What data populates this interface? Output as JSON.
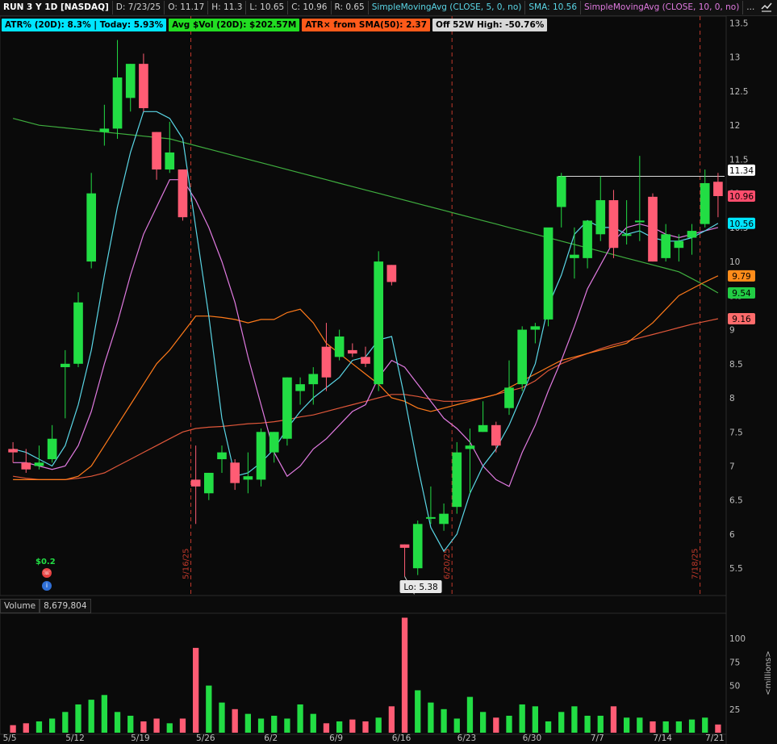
{
  "header": {
    "symbol": "RUN 3 Y 1D [NASDAQ]",
    "date": "D: 7/23/25",
    "open": "O: 11.17",
    "high": "H: 11.3",
    "low": "L: 10.65",
    "close": "C: 10.96",
    "range": "R: 0.65",
    "sma5_label": "SimpleMovingAvg (CLOSE, 5, 0, no)",
    "sma5_value": "SMA: 10.56",
    "sma10_label": "SimpleMovingAvg (CLOSE, 10, 0, no)",
    "more": "..."
  },
  "badges": [
    {
      "text": "ATR% (20D): 8.3% | Today: 5.93%",
      "color": "#00e5ff"
    },
    {
      "text": "Avg $Vol (20D): $202.57M",
      "color": "#22dd22"
    },
    {
      "text": "ATR× from SMA(50): 2.37",
      "color": "#ff5a1a"
    },
    {
      "text": "Off 52W High: -50.76%",
      "color": "#d8d8d8"
    }
  ],
  "price_axis": {
    "ticks": [
      "13.5",
      "13",
      "12.5",
      "12",
      "11.5",
      "11",
      "10.5",
      "10",
      "9.5",
      "9",
      "8.5",
      "8",
      "7.5",
      "7",
      "6.5",
      "6",
      "5.5"
    ],
    "tags": [
      {
        "label": "11.34",
        "bg": "#ffffff",
        "fg": "#000000"
      },
      {
        "label": "10.96",
        "bg": "#ff4d6d",
        "fg": "#000000"
      },
      {
        "label": "10.56",
        "bg": "#00e5ff",
        "fg": "#000000"
      },
      {
        "label": "9.79",
        "bg": "#ff8c1a",
        "fg": "#000000"
      },
      {
        "label": "9.54",
        "bg": "#22cc44",
        "fg": "#000000"
      },
      {
        "label": "9.16",
        "bg": "#ff6b6b",
        "fg": "#000000"
      }
    ]
  },
  "date_axis": [
    "5/5",
    "5/12",
    "5/19",
    "5/26",
    "6/2",
    "6/9",
    "6/16",
    "6/23",
    "6/30",
    "7/7",
    "7/14",
    "7/21"
  ],
  "vertical_markers": [
    "5/16/25",
    "6/20/25",
    "7/18/25"
  ],
  "low_label": "Lo: 5.38",
  "event": {
    "dividend": "$0.2"
  },
  "volume": {
    "label": "Volume",
    "value": "8,679,804",
    "ticks": [
      "100",
      "75",
      "50",
      "25"
    ],
    "unit": "<millions>"
  },
  "colors": {
    "up": "#22dd44",
    "down": "#ff5c74",
    "sma5": "#5ad6e6",
    "sma10": "#e07ae0",
    "sma_orange": "#ff7a1a",
    "sma_red": "#e0573a",
    "sma_green": "#3fae3f"
  },
  "chart_data": {
    "type": "candlestick",
    "ylim": [
      5.1,
      13.6
    ],
    "candles": [
      {
        "o": 7.25,
        "h": 7.35,
        "l": 7.05,
        "c": 7.2
      },
      {
        "o": 7.05,
        "h": 7.25,
        "l": 6.9,
        "c": 6.95
      },
      {
        "o": 7.0,
        "h": 7.3,
        "l": 6.95,
        "c": 7.05
      },
      {
        "o": 7.1,
        "h": 7.6,
        "l": 7.05,
        "c": 7.4
      },
      {
        "o": 8.45,
        "h": 8.7,
        "l": 7.7,
        "c": 8.5
      },
      {
        "o": 8.5,
        "h": 9.55,
        "l": 8.45,
        "c": 9.4
      },
      {
        "o": 10.0,
        "h": 11.3,
        "l": 9.9,
        "c": 11.0
      },
      {
        "o": 11.9,
        "h": 12.3,
        "l": 11.7,
        "c": 11.95
      },
      {
        "o": 11.95,
        "h": 13.25,
        "l": 11.8,
        "c": 12.7
      },
      {
        "o": 12.4,
        "h": 12.9,
        "l": 12.2,
        "c": 12.9
      },
      {
        "o": 12.9,
        "h": 13.05,
        "l": 12.2,
        "c": 12.25
      },
      {
        "o": 11.9,
        "h": 11.9,
        "l": 11.2,
        "c": 11.35
      },
      {
        "o": 11.35,
        "h": 12.05,
        "l": 11.3,
        "c": 11.6
      },
      {
        "o": 11.35,
        "h": 11.35,
        "l": 10.6,
        "c": 10.65
      },
      {
        "o": 6.8,
        "h": 7.3,
        "l": 6.15,
        "c": 6.7
      },
      {
        "o": 6.6,
        "h": 6.9,
        "l": 6.5,
        "c": 6.9
      },
      {
        "o": 7.1,
        "h": 7.3,
        "l": 6.9,
        "c": 7.2
      },
      {
        "o": 7.05,
        "h": 7.1,
        "l": 6.65,
        "c": 6.75
      },
      {
        "o": 6.8,
        "h": 7.2,
        "l": 6.6,
        "c": 6.85
      },
      {
        "o": 6.8,
        "h": 7.55,
        "l": 6.7,
        "c": 7.5
      },
      {
        "o": 7.2,
        "h": 7.5,
        "l": 7.05,
        "c": 7.5
      },
      {
        "o": 7.4,
        "h": 8.3,
        "l": 7.3,
        "c": 8.3
      },
      {
        "o": 8.1,
        "h": 8.3,
        "l": 7.9,
        "c": 8.2
      },
      {
        "o": 8.2,
        "h": 8.45,
        "l": 7.9,
        "c": 8.35
      },
      {
        "o": 8.75,
        "h": 9.1,
        "l": 8.1,
        "c": 8.3
      },
      {
        "o": 8.6,
        "h": 9.0,
        "l": 8.55,
        "c": 8.9
      },
      {
        "o": 8.7,
        "h": 8.8,
        "l": 8.6,
        "c": 8.65
      },
      {
        "o": 8.6,
        "h": 8.75,
        "l": 8.45,
        "c": 8.5
      },
      {
        "o": 8.2,
        "h": 10.15,
        "l": 8.1,
        "c": 10.0
      },
      {
        "o": 9.95,
        "h": 9.95,
        "l": 9.65,
        "c": 9.7
      },
      {
        "o": 5.85,
        "h": 5.85,
        "l": 5.38,
        "c": 5.8
      },
      {
        "o": 5.5,
        "h": 6.2,
        "l": 5.4,
        "c": 6.15
      },
      {
        "o": 6.25,
        "h": 6.7,
        "l": 6.15,
        "c": 6.25
      },
      {
        "o": 6.15,
        "h": 6.45,
        "l": 6.05,
        "c": 6.3
      },
      {
        "o": 6.4,
        "h": 7.35,
        "l": 6.3,
        "c": 7.2
      },
      {
        "o": 7.25,
        "h": 7.55,
        "l": 6.6,
        "c": 7.3
      },
      {
        "o": 7.5,
        "h": 7.95,
        "l": 7.5,
        "c": 7.6
      },
      {
        "o": 7.6,
        "h": 7.65,
        "l": 7.2,
        "c": 7.3
      },
      {
        "o": 7.85,
        "h": 8.55,
        "l": 7.75,
        "c": 8.15
      },
      {
        "o": 8.2,
        "h": 9.05,
        "l": 8.1,
        "c": 9.0
      },
      {
        "o": 9.0,
        "h": 9.1,
        "l": 8.8,
        "c": 9.05
      },
      {
        "o": 9.15,
        "h": 10.2,
        "l": 9.05,
        "c": 10.5
      },
      {
        "o": 10.8,
        "h": 11.3,
        "l": 10.5,
        "c": 11.25
      },
      {
        "o": 10.05,
        "h": 10.5,
        "l": 9.75,
        "c": 10.1
      },
      {
        "o": 10.05,
        "h": 10.5,
        "l": 9.9,
        "c": 10.6
      },
      {
        "o": 10.4,
        "h": 11.25,
        "l": 10.3,
        "c": 10.9
      },
      {
        "o": 10.9,
        "h": 11.05,
        "l": 10.05,
        "c": 10.2
      },
      {
        "o": 10.4,
        "h": 10.9,
        "l": 10.25,
        "c": 10.4
      },
      {
        "o": 10.6,
        "h": 11.55,
        "l": 10.3,
        "c": 10.6
      },
      {
        "o": 10.95,
        "h": 11.0,
        "l": 10.0,
        "c": 10.0
      },
      {
        "o": 10.05,
        "h": 10.55,
        "l": 10.0,
        "c": 10.4
      },
      {
        "o": 10.2,
        "h": 10.4,
        "l": 10.0,
        "c": 10.3
      },
      {
        "o": 10.35,
        "h": 10.55,
        "l": 10.1,
        "c": 10.45
      },
      {
        "o": 10.55,
        "h": 11.35,
        "l": 10.5,
        "c": 11.15
      },
      {
        "o": 11.17,
        "h": 11.3,
        "l": 10.65,
        "c": 10.96
      }
    ],
    "sma5": [
      7.25,
      7.2,
      7.1,
      7.0,
      7.3,
      7.9,
      8.7,
      9.8,
      10.8,
      11.6,
      12.2,
      12.2,
      12.1,
      11.8,
      10.5,
      9.2,
      7.7,
      6.85,
      6.9,
      7.05,
      7.25,
      7.55,
      7.8,
      8.0,
      8.15,
      8.3,
      8.55,
      8.6,
      8.85,
      8.9,
      8.0,
      7.0,
      6.1,
      5.75,
      6.0,
      6.6,
      7.0,
      7.25,
      7.6,
      8.05,
      8.5,
      9.35,
      9.8,
      10.4,
      10.6,
      10.5,
      10.5,
      10.4,
      10.45,
      10.35,
      10.3,
      10.3,
      10.35,
      10.45,
      10.56
    ],
    "sma10": [
      7.05,
      7.05,
      7.0,
      6.95,
      7.0,
      7.3,
      7.8,
      8.5,
      9.1,
      9.8,
      10.4,
      10.8,
      11.2,
      11.2,
      10.9,
      10.5,
      10.0,
      9.4,
      8.6,
      7.9,
      7.2,
      6.85,
      7.0,
      7.25,
      7.4,
      7.6,
      7.8,
      7.9,
      8.3,
      8.55,
      8.45,
      8.2,
      7.95,
      7.7,
      7.55,
      7.35,
      7.0,
      6.8,
      6.7,
      7.2,
      7.6,
      8.1,
      8.55,
      9.05,
      9.6,
      9.95,
      10.3,
      10.5,
      10.55,
      10.5,
      10.4,
      10.35,
      10.4,
      10.45,
      10.5
    ],
    "sma_orange": [
      6.8,
      6.8,
      6.8,
      6.8,
      6.8,
      6.85,
      7.0,
      7.3,
      7.6,
      7.9,
      8.2,
      8.5,
      8.7,
      8.95,
      9.2,
      9.2,
      9.18,
      9.15,
      9.1,
      9.15,
      9.15,
      9.25,
      9.3,
      9.1,
      8.8,
      8.65,
      8.5,
      8.35,
      8.2,
      8.0,
      7.95,
      7.85,
      7.8,
      7.85,
      7.9,
      7.95,
      8.0,
      8.05,
      8.15,
      8.25,
      8.35,
      8.45,
      8.55,
      8.6,
      8.65,
      8.7,
      8.75,
      8.8,
      8.95,
      9.1,
      9.3,
      9.5,
      9.6,
      9.7,
      9.79
    ],
    "sma_red": [
      6.85,
      6.82,
      6.8,
      6.8,
      6.8,
      6.82,
      6.85,
      6.9,
      7.0,
      7.1,
      7.2,
      7.3,
      7.4,
      7.5,
      7.55,
      7.57,
      7.58,
      7.6,
      7.62,
      7.63,
      7.65,
      7.68,
      7.72,
      7.75,
      7.8,
      7.85,
      7.9,
      7.95,
      8.0,
      8.05,
      8.05,
      8.02,
      7.98,
      7.95,
      7.95,
      7.97,
      8.0,
      8.05,
      8.1,
      8.15,
      8.25,
      8.4,
      8.5,
      8.58,
      8.65,
      8.72,
      8.78,
      8.83,
      8.88,
      8.93,
      8.98,
      9.03,
      9.08,
      9.12,
      9.16
    ],
    "sma_green": [
      12.1,
      12.05,
      12.0,
      11.98,
      11.96,
      11.94,
      11.92,
      11.9,
      11.88,
      11.86,
      11.84,
      11.82,
      11.8,
      11.75,
      11.7,
      11.65,
      11.6,
      11.55,
      11.5,
      11.45,
      11.4,
      11.35,
      11.3,
      11.25,
      11.2,
      11.15,
      11.1,
      11.05,
      11.0,
      10.95,
      10.9,
      10.85,
      10.8,
      10.75,
      10.7,
      10.65,
      10.6,
      10.55,
      10.5,
      10.45,
      10.4,
      10.35,
      10.3,
      10.25,
      10.2,
      10.15,
      10.1,
      10.05,
      10.0,
      9.95,
      9.9,
      9.85,
      9.75,
      9.65,
      9.54
    ],
    "resistance": 11.25,
    "volume": [
      8,
      10,
      12,
      15,
      22,
      30,
      35,
      40,
      22,
      18,
      12,
      15,
      10,
      15,
      90,
      50,
      32,
      25,
      20,
      15,
      18,
      15,
      30,
      20,
      10,
      12,
      14,
      12,
      16,
      28,
      122,
      45,
      32,
      25,
      15,
      38,
      22,
      16,
      18,
      30,
      28,
      12,
      22,
      28,
      18,
      18,
      28,
      16,
      16,
      12,
      12,
      12,
      14,
      16,
      8.7
    ]
  }
}
